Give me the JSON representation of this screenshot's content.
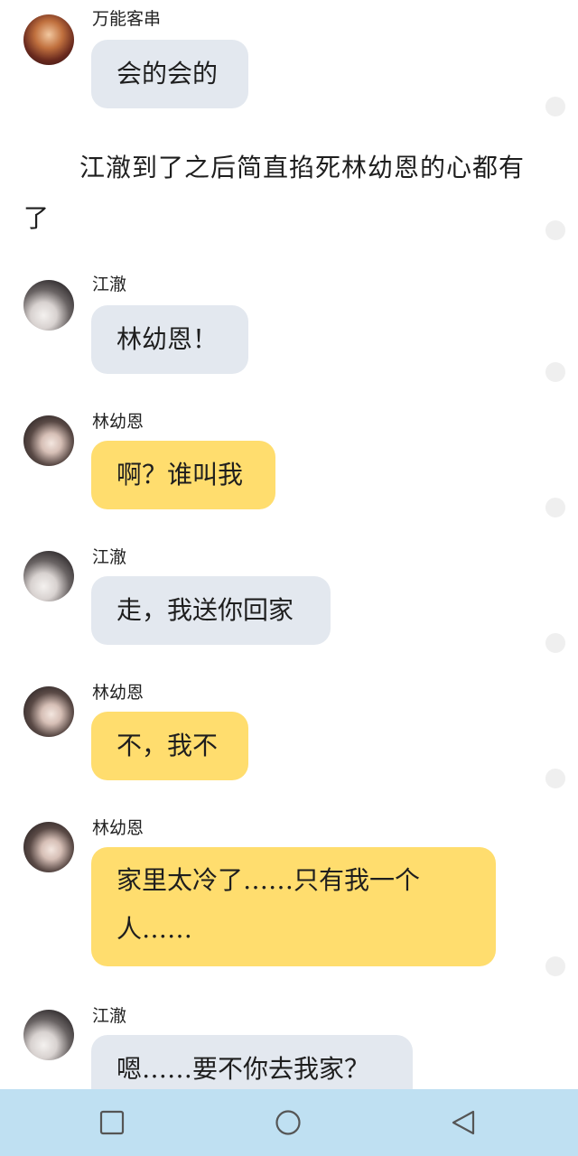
{
  "messages": [
    {
      "sender": "万能客串",
      "text": "会的会的",
      "style": "grey",
      "avatar": "wanneng-avatar"
    },
    {
      "narration": "江澈到了之后简直掐死林幼恩的心都有了"
    },
    {
      "sender": "江澈",
      "text": "林幼恩！",
      "style": "grey",
      "avatar": "jiangche-avatar"
    },
    {
      "sender": "林幼恩",
      "text": "啊？谁叫我",
      "style": "yellow",
      "avatar": "lin-avatar"
    },
    {
      "sender": "江澈",
      "text": "走，我送你回家",
      "style": "grey",
      "avatar": "jiangche-avatar"
    },
    {
      "sender": "林幼恩",
      "text": "不，我不",
      "style": "yellow",
      "avatar": "lin-avatar"
    },
    {
      "sender": "林幼恩",
      "text": "家里太冷了……只有我一个人……",
      "style": "yellow",
      "avatar": "lin-avatar"
    },
    {
      "sender": "江澈",
      "text": "嗯……要不你去我家？",
      "style": "grey",
      "avatar": "jiangche-avatar"
    }
  ],
  "colors": {
    "grey_bubble": "#e3e8ef",
    "yellow_bubble": "#ffdd6e",
    "navbar": "#bfe0f2"
  },
  "navbar": {
    "buttons": [
      "recent-apps-icon",
      "home-icon",
      "back-icon"
    ]
  }
}
